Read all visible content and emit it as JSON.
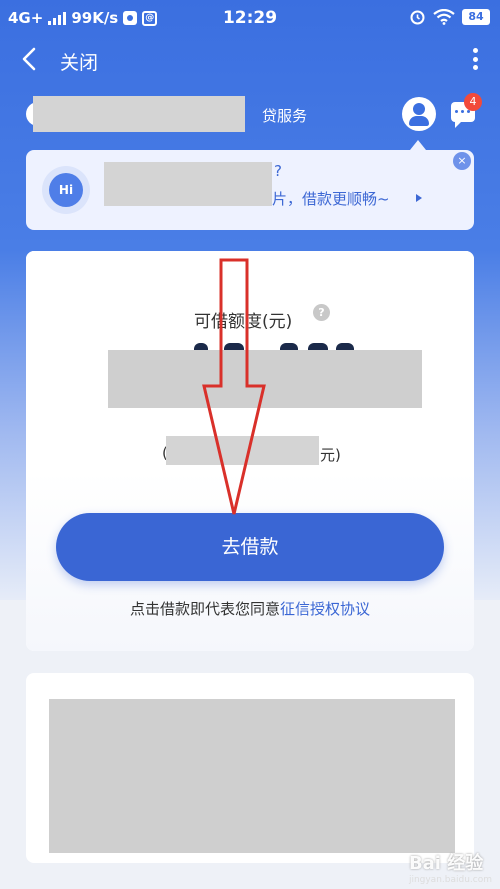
{
  "status_bar": {
    "network": "4G+",
    "speed": "99K/s",
    "time": "12:29",
    "battery": "84"
  },
  "nav": {
    "title": "关闭"
  },
  "service": {
    "suffix": "贷服务",
    "badge_count": "4"
  },
  "banner": {
    "hi": "Hi",
    "line1": "?",
    "line2": "片，借款更顺畅~",
    "close": "×"
  },
  "loan": {
    "amount_label": "可借额度(元)",
    "help": "?",
    "sub_paren": "(",
    "sub_unit": "元)",
    "button_label": "去借款",
    "agree_prefix": "点击借款即代表您同意",
    "agree_link": "征信授权协议"
  },
  "watermark": {
    "text": "Bai 经验",
    "sub": "jingyan.baidu.com"
  },
  "colors": {
    "primary": "#3a66d4",
    "badge": "#f24a3a",
    "arrow": "#d9302a"
  }
}
